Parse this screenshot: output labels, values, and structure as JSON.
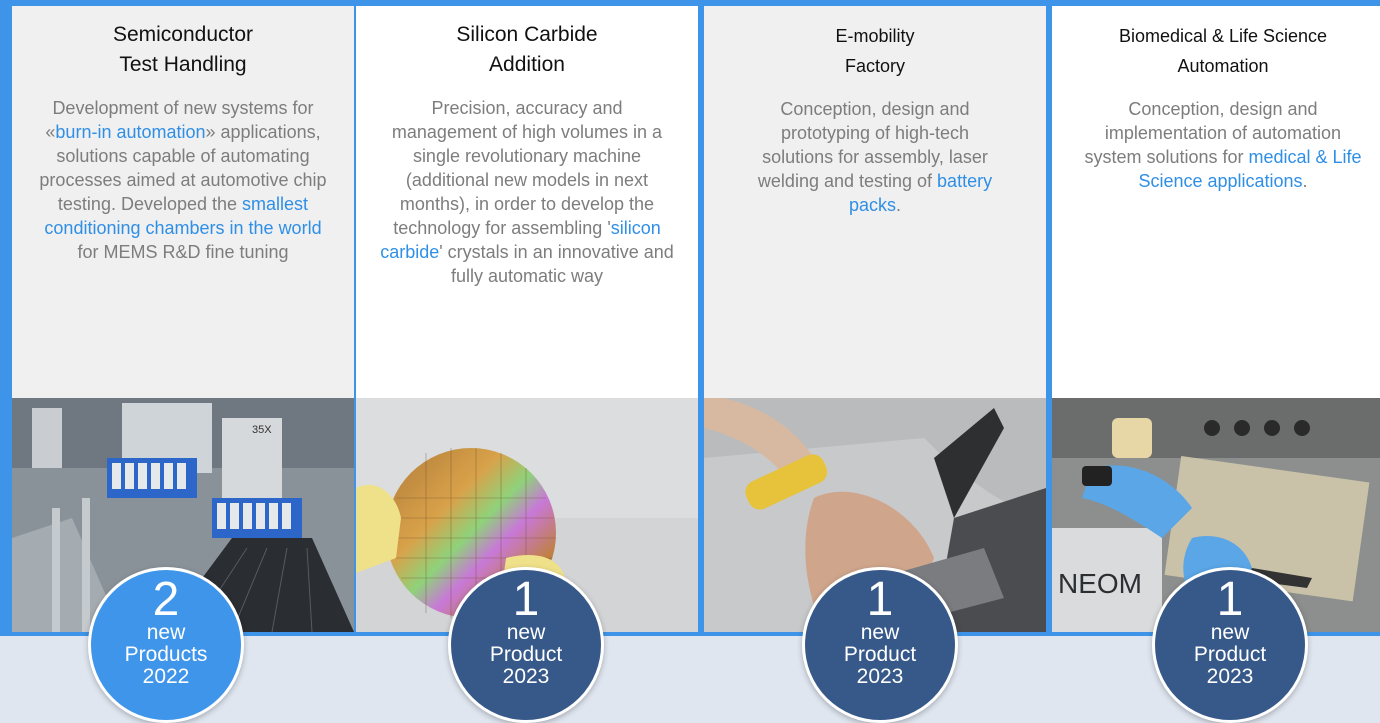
{
  "columns": [
    {
      "title_line1": "Semiconductor",
      "title_line2": "Test Handling",
      "desc": [
        {
          "t": "Development of new systems for «",
          "h": false
        },
        {
          "t": "burn-in automation",
          "h": true
        },
        {
          "t": "» applications, solutions capable of automating processes aimed at automotive chip testing. Developed the ",
          "h": false
        },
        {
          "t": "smallest conditioning chambers in the world",
          "h": true
        },
        {
          "t": " for MEMS R&D fine tuning",
          "h": false
        }
      ],
      "photo": "semiconductor-test-handler-photo",
      "badge": {
        "number": "2",
        "line1": "new",
        "line2": "Products",
        "line3": "2022"
      }
    },
    {
      "title_line1": "Silicon Carbide",
      "title_line2": "Addition",
      "desc": [
        {
          "t": "Precision, accuracy and management of high volumes in a single revolutionary machine (additional new models in next months), in order to develop the technology for assembling '",
          "h": false
        },
        {
          "t": "silicon carbide",
          "h": true
        },
        {
          "t": "' crystals in an innovative and fully automatic way",
          "h": false
        }
      ],
      "photo": "silicon-carbide-wafer-photo",
      "badge": {
        "number": "1",
        "line1": "new",
        "line2": "Product",
        "line3": "2023"
      }
    },
    {
      "title_line1": "E-mobility",
      "title_line2": "Factory",
      "desc": [
        {
          "t": "Conception, design and prototyping of high-tech solutions for assembly, laser welding and testing of ",
          "h": false
        },
        {
          "t": "battery packs",
          "h": true
        },
        {
          "t": ".",
          "h": false
        }
      ],
      "photo": "battery-pack-assembly-photo",
      "badge": {
        "number": "1",
        "line1": "new",
        "line2": "Product",
        "line3": "2023"
      }
    },
    {
      "title_line1": "Biomedical & Life Science",
      "title_line2": "Automation",
      "desc": [
        {
          "t": "Conception, design and implementation of automation system solutions for ",
          "h": false
        },
        {
          "t": "medical & Life Science applications",
          "h": true
        },
        {
          "t": ".",
          "h": false
        }
      ],
      "photo": "life-science-automation-photo",
      "badge": {
        "number": "1",
        "line1": "new",
        "line2": "Product",
        "line3": "2023"
      }
    }
  ],
  "colors": {
    "frame": "#3e94e8",
    "highlight": "#2f8fe6",
    "badge_light": "#3f95e9",
    "badge_dark": "#37598a"
  },
  "photo_texts": {
    "label_35x": "35X",
    "brand_fragment": "NEOM"
  }
}
